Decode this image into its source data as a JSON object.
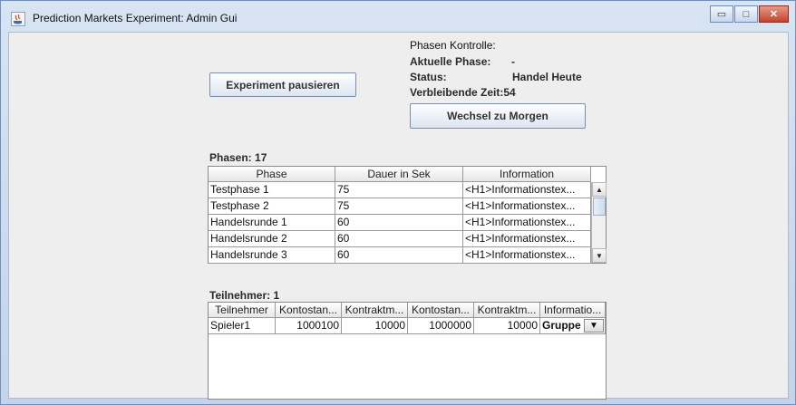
{
  "window": {
    "title": "Prediction Markets Experiment: Admin Gui",
    "controls": {
      "minimize": "▭",
      "maximize": "□",
      "close": "✕"
    }
  },
  "controls_panel": {
    "pause_button": "Experiment pausieren",
    "phase_control_label": "Phasen Kontrolle:",
    "current_phase_label": "Aktuelle Phase:",
    "current_phase_value": "-",
    "status_label": "Status:",
    "status_value": "Handel Heute",
    "remaining_time": "Verbleibende Zeit:54",
    "switch_button": "Wechsel zu Morgen"
  },
  "phases": {
    "title": "Phasen: 17",
    "columns": [
      "Phase",
      "Dauer in Sek",
      "Information"
    ],
    "rows": [
      [
        "Testphase 1",
        "75",
        "<H1>Informationstex..."
      ],
      [
        "Testphase 2",
        "75",
        "<H1>Informationstex..."
      ],
      [
        "Handelsrunde 1",
        "60",
        "<H1>Informationstex..."
      ],
      [
        "Handelsrunde 2",
        "60",
        "<H1>Informationstex..."
      ],
      [
        "Handelsrunde 3",
        "60",
        "<H1>Informationstex..."
      ]
    ],
    "scroll_up": "▲",
    "scroll_down": "▼"
  },
  "participants": {
    "title": "Teilnehmer: 1",
    "columns": [
      "Teilnehmer",
      "Kontostan...",
      "Kontraktm...",
      "Kontostan...",
      "Kontraktm...",
      "Informatio..."
    ],
    "rows": [
      [
        "Spieler1",
        "1000100",
        "10000",
        "1000000",
        "10000",
        "Gruppe"
      ]
    ],
    "dropdown_arrow": "▼"
  }
}
